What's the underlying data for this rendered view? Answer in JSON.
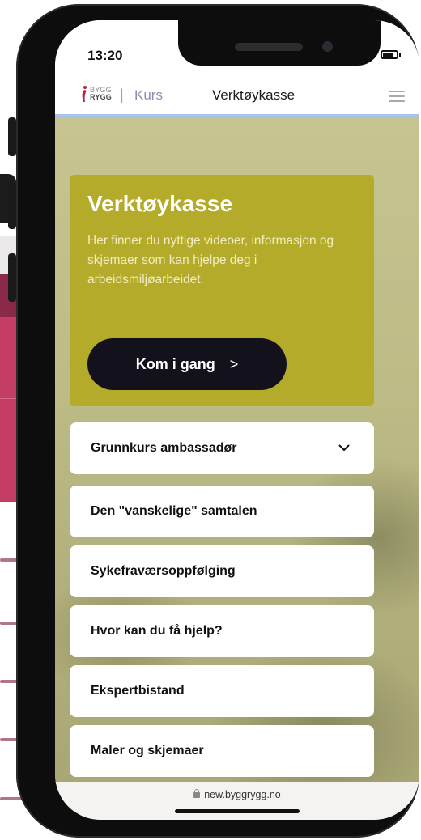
{
  "status_bar": {
    "time": "13:20"
  },
  "nav": {
    "logo_line1": "BYGG",
    "logo_line2": "RYGG",
    "separator": "|",
    "kurs_label": "Kurs",
    "page_title": "Verktøykasse"
  },
  "hero": {
    "title": "Verktøykasse",
    "description": "Her finner du nyttige videoer, informasjon og skjemaer som kan hjelpe deg i arbeidsmiljøarbeidet.",
    "cta_label": "Kom i gang",
    "cta_chevron": ">"
  },
  "accordion": [
    {
      "label": "Grunnkurs ambassadør",
      "has_chevron": true
    },
    {
      "label": "Den \"vanskelige\" samtalen"
    },
    {
      "label": "Sykefraværsoppfølging"
    },
    {
      "label": "Hvor kan du få hjelp?"
    },
    {
      "label": "Ekspertbistand"
    },
    {
      "label": "Maler og skjemaer"
    }
  ],
  "browser": {
    "url": "new.byggrygg.no"
  },
  "colors": {
    "hero_bg": "#b5ab2a",
    "cta_bg": "#13121c",
    "nav_accent": "#a9c4e6",
    "page_bg_accent": "#c43d64"
  }
}
